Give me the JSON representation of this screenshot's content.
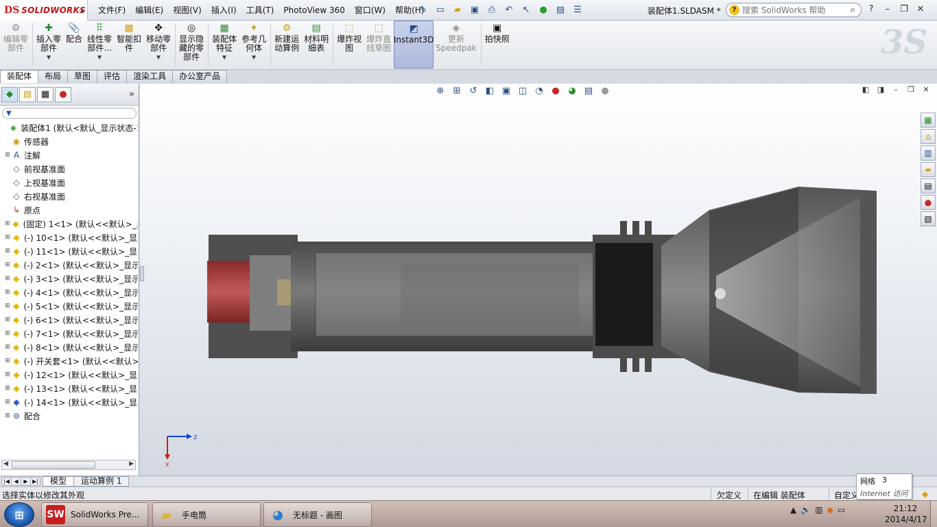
{
  "app": {
    "logo_mark": "DS",
    "logo_text": "SOLIDWORKS",
    "document_title": "装配体1.SLDASM *"
  },
  "menu": [
    "文件(F)",
    "编辑(E)",
    "视图(V)",
    "插入(I)",
    "工具(T)",
    "PhotoView 360",
    "窗口(W)",
    "帮助(H)"
  ],
  "search": {
    "placeholder": "搜索 SolidWorks 帮助",
    "badge": "?"
  },
  "window_buttons": [
    "?",
    "–",
    "❐",
    "✕"
  ],
  "commands": [
    {
      "label": "编辑零\n部件",
      "icon": "edit-part-icon",
      "disabled": true
    },
    {
      "label": "插入零\n部件",
      "icon": "insert-component-icon",
      "dropdown": true
    },
    {
      "label": "配合",
      "icon": "mate-icon"
    },
    {
      "label": "线性零\n部件...",
      "icon": "linear-pattern-icon",
      "dropdown": true
    },
    {
      "label": "智能扣\n件",
      "icon": "smart-fastener-icon"
    },
    {
      "label": "移动零\n部件",
      "icon": "move-component-icon",
      "dropdown": true
    },
    {
      "label": "显示隐\n藏的零\n部件",
      "icon": "show-hidden-icon"
    },
    {
      "label": "装配体\n特征",
      "icon": "assembly-feature-icon",
      "dropdown": true
    },
    {
      "label": "参考几\n何体",
      "icon": "reference-geometry-icon",
      "dropdown": true
    },
    {
      "label": "新建运\n动算例",
      "icon": "motion-study-icon"
    },
    {
      "label": "材料明\n细表",
      "icon": "bom-icon"
    },
    {
      "label": "爆炸视\n图",
      "icon": "exploded-view-icon"
    },
    {
      "label": "爆炸直\n线草图",
      "icon": "explode-line-icon",
      "disabled": true
    },
    {
      "label": "Instant3D",
      "icon": "instant3d-icon",
      "active": true
    },
    {
      "label": "更新\nSpeedpak",
      "icon": "speedpak-icon",
      "disabled": true
    },
    {
      "label": "拍快照",
      "icon": "snapshot-icon"
    }
  ],
  "command_tabs": [
    "装配体",
    "布局",
    "草图",
    "评估",
    "渲染工具",
    "办公室产品"
  ],
  "tree": [
    {
      "label": "装配体1 (默认<默认_显示状态-1",
      "icon": "assembly-icon",
      "indent": 0
    },
    {
      "label": "传感器",
      "icon": "sensor-icon",
      "indent": 1
    },
    {
      "label": "注解",
      "icon": "annotation-icon",
      "indent": 1,
      "toggle": true
    },
    {
      "label": "前视基准面",
      "icon": "plane-icon",
      "indent": 1
    },
    {
      "label": "上视基准面",
      "icon": "plane-icon",
      "indent": 1
    },
    {
      "label": "右视基准面",
      "icon": "plane-icon",
      "indent": 1
    },
    {
      "label": "原点",
      "icon": "origin-icon",
      "indent": 1
    },
    {
      "label": "(固定) 1<1> (默认<<默认>_显",
      "icon": "part-icon",
      "indent": 1,
      "toggle": true
    },
    {
      "label": "(-) 10<1> (默认<<默认>_显",
      "icon": "part-icon",
      "indent": 1,
      "toggle": true
    },
    {
      "label": "(-) 11<1> (默认<<默认>_显",
      "icon": "part-icon",
      "indent": 1,
      "toggle": true
    },
    {
      "label": "(-) 2<1> (默认<<默认>_显示",
      "icon": "part-icon",
      "indent": 1,
      "toggle": true
    },
    {
      "label": "(-) 3<1> (默认<<默认>_显示",
      "icon": "part-icon",
      "indent": 1,
      "toggle": true
    },
    {
      "label": "(-) 4<1> (默认<<默认>_显示",
      "icon": "part-icon",
      "indent": 1,
      "toggle": true
    },
    {
      "label": "(-) 5<1> (默认<<默认>_显示",
      "icon": "part-icon",
      "indent": 1,
      "toggle": true
    },
    {
      "label": "(-) 6<1> (默认<<默认>_显示",
      "icon": "part-icon",
      "indent": 1,
      "toggle": true
    },
    {
      "label": "(-) 7<1> (默认<<默认>_显示",
      "icon": "part-icon",
      "indent": 1,
      "toggle": true
    },
    {
      "label": "(-) 8<1> (默认<<默认>_显示",
      "icon": "part-icon",
      "indent": 1,
      "toggle": true
    },
    {
      "label": "(-) 开关套<1> (默认<<默认>",
      "icon": "part-icon",
      "indent": 1,
      "toggle": true
    },
    {
      "label": "(-) 12<1> (默认<<默认>_显",
      "icon": "part-icon",
      "indent": 1,
      "toggle": true
    },
    {
      "label": "(-) 13<1> (默认<<默认>_显",
      "icon": "part-icon",
      "indent": 1,
      "toggle": true
    },
    {
      "label": "(-) 14<1> (默认<<默认>_显",
      "icon": "part-icon-blue",
      "indent": 1,
      "toggle": true
    },
    {
      "label": "配合",
      "icon": "mates-folder-icon",
      "indent": 1,
      "toggle": true
    }
  ],
  "triad": {
    "x_label": "X",
    "z_label": "Z"
  },
  "bottom_tabs": [
    "模型",
    "运动算例 1"
  ],
  "status": {
    "message": "选择实体以修改其外观",
    "definition": "欠定义",
    "editing": "在编辑 装配体",
    "custom": "自定义"
  },
  "tooltip": {
    "network": "网络",
    "count": "3",
    "access": "Internet 访问"
  },
  "taskbar": {
    "buttons": [
      {
        "label": "SolidWorks Pre...",
        "icon": "SW"
      },
      {
        "label": "手电筒",
        "icon": "folder"
      },
      {
        "label": "无标题 - 画图",
        "icon": "paint"
      }
    ],
    "time": "21:12",
    "date": "2014/4/17"
  },
  "colors": {
    "accent": "#d21919",
    "active_cmd": "#aeb9dc",
    "part_icon": "#e3b80c"
  }
}
